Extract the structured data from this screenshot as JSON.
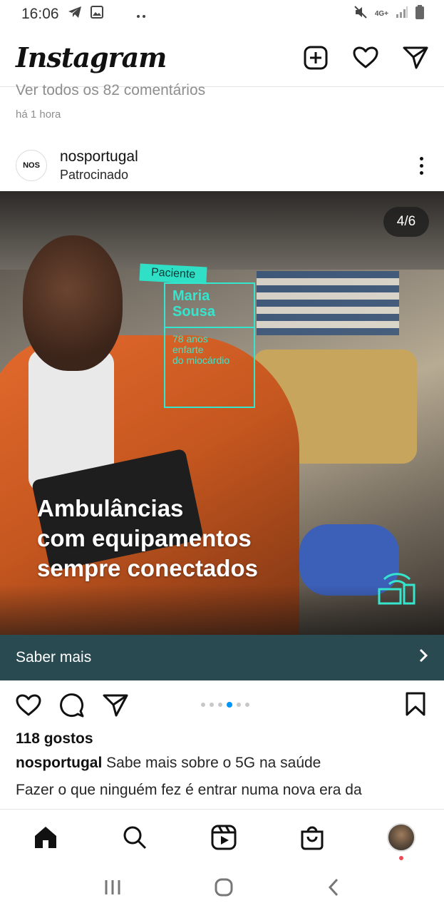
{
  "status_bar": {
    "time": "16:06",
    "left_icons": [
      "telegram-icon",
      "gallery-icon",
      "more-dots-icon"
    ],
    "network": "4G+",
    "right_icons": [
      "mute-icon",
      "signal-icon",
      "battery-icon"
    ]
  },
  "header": {
    "logo": "Instagram",
    "icons": [
      "new-post-icon",
      "heart-icon",
      "direct-message-icon"
    ]
  },
  "previous_post": {
    "comments_link": "Ver todos os 82 comentários",
    "time": "há 1 hora"
  },
  "post": {
    "username": "nosportugal",
    "subtitle": "Patrocinado",
    "avatar_text": "NOS",
    "counter": "4/6",
    "image_overlay": {
      "tag": "Paciente",
      "name_line1": "Maria",
      "name_line2": "Sousa",
      "info_line1": "78 anos",
      "info_line2": "enfarte",
      "info_line3": "do miocárdio",
      "headline_line1": "Ambulâncias",
      "headline_line2": "com equipamentos",
      "headline_line3": "sempre conectados"
    },
    "cta_label": "Saber mais",
    "carousel_dots": 5,
    "carousel_active_index": 3,
    "likes": "118 gostos",
    "caption_user": "nosportugal",
    "caption_text": "Sabe mais sobre o 5G na saúde",
    "caption_more": "Fazer o que ninguém fez é entrar numa nova era da"
  },
  "bottom_nav": {
    "items": [
      "home-icon",
      "search-icon",
      "reels-icon",
      "shop-icon",
      "profile-avatar"
    ]
  },
  "colors": {
    "cta_bg": "#2a4a52",
    "accent_teal": "#35e6cf",
    "active_dot": "#0095f6",
    "notification_dot": "#ed4956"
  }
}
